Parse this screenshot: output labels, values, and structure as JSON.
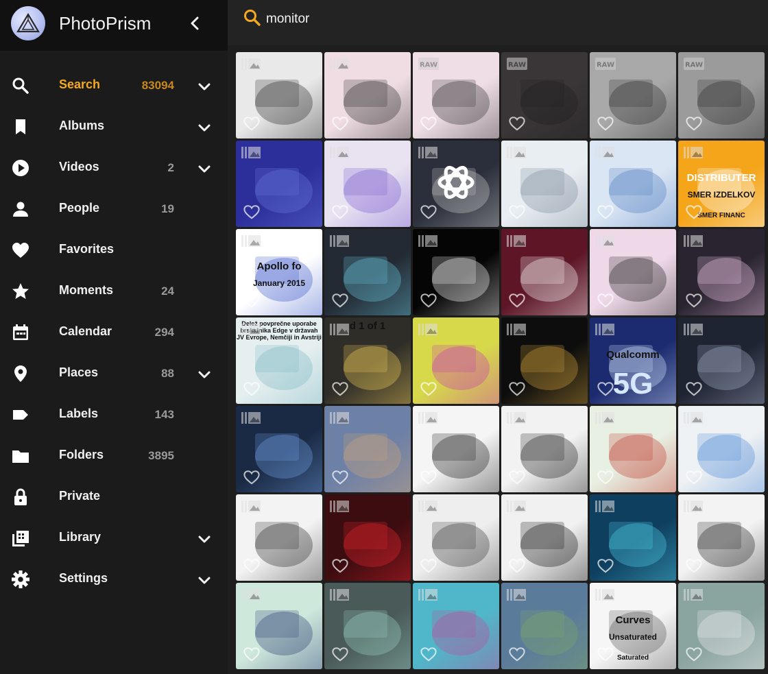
{
  "app": {
    "title": "PhotoPrism"
  },
  "search": {
    "value": "monitor"
  },
  "nav": [
    {
      "label": "Search",
      "count": "83094",
      "chevron": true,
      "active": true,
      "icon": "search-icon"
    },
    {
      "label": "Albums",
      "count": "",
      "chevron": true,
      "icon": "bookmark-icon"
    },
    {
      "label": "Videos",
      "count": "2",
      "chevron": true,
      "icon": "play-circle-icon"
    },
    {
      "label": "People",
      "count": "19",
      "chevron": false,
      "icon": "person-icon"
    },
    {
      "label": "Favorites",
      "count": "",
      "chevron": false,
      "icon": "heart-icon"
    },
    {
      "label": "Moments",
      "count": "24",
      "chevron": false,
      "icon": "star-icon"
    },
    {
      "label": "Calendar",
      "count": "294",
      "chevron": false,
      "icon": "calendar-icon"
    },
    {
      "label": "Places",
      "count": "88",
      "chevron": true,
      "icon": "map-pin-icon"
    },
    {
      "label": "Labels",
      "count": "143",
      "chevron": false,
      "icon": "label-icon"
    },
    {
      "label": "Folders",
      "count": "3895",
      "chevron": false,
      "icon": "folder-icon"
    },
    {
      "label": "Private",
      "count": "",
      "chevron": false,
      "icon": "lock-icon"
    },
    {
      "label": "Library",
      "count": "",
      "chevron": true,
      "icon": "library-icon"
    },
    {
      "label": "Settings",
      "count": "",
      "chevron": true,
      "icon": "gear-icon"
    }
  ],
  "colors": {
    "accent": "#f6a91c",
    "sidebar": "#1b1b1b",
    "brand_bar": "#111111",
    "main": "#1e1e1e"
  },
  "tiles": [
    {
      "bg": "#e9e9e9",
      "fg": "#2b2b2b",
      "badge": "image"
    },
    {
      "bg": "#f0dde4",
      "fg": "#2c2c2c",
      "badge": "image"
    },
    {
      "bg": "#efdee6",
      "fg": "#333333",
      "badge": "raw"
    },
    {
      "bg": "#3a3638",
      "fg": "#1e1e1e",
      "badge": "raw"
    },
    {
      "bg": "#a9a8a8",
      "fg": "#2d2d2d",
      "badge": "raw"
    },
    {
      "bg": "#9c9b9b",
      "fg": "#2a2a2a",
      "badge": "raw"
    },
    {
      "bg": "#2c2f9a",
      "fg": "#6b78e0",
      "badge": "image"
    },
    {
      "bg": "#e8e2f1",
      "fg": "#7a5bd1",
      "badge": "image"
    },
    {
      "bg": "#2b2f3b",
      "fg": "#cccccc",
      "badge": "image",
      "caption": "",
      "glyph": "knot"
    },
    {
      "bg": "#e9eef3",
      "fg": "#7d8c9c",
      "badge": "image"
    },
    {
      "bg": "#dbe6f4",
      "fg": "#4a7bc0",
      "badge": "image"
    },
    {
      "bg": "#f4a51a",
      "fg": "#ffffff",
      "badge": "image",
      "text1": "DISTRIBUTER",
      "text2": "SMER IZDELKOV",
      "text3": "SMER FINANC"
    },
    {
      "bg": "#ffffff",
      "fg": "#3a57c9",
      "badge": "image",
      "text1": "Apollo fo",
      "text2": "January 2015"
    },
    {
      "bg": "#232a33",
      "fg": "#6ac8df",
      "badge": "image"
    },
    {
      "bg": "#050505",
      "fg": "#ffffff",
      "badge": "image"
    },
    {
      "bg": "#5e1627",
      "fg": "#ffffff",
      "badge": "image"
    },
    {
      "bg": "#efd9e9",
      "fg": "#222222",
      "badge": "image"
    },
    {
      "bg": "#2a2430",
      "fg": "#f0c6e8",
      "badge": "image"
    },
    {
      "bg": "#e6eff0",
      "fg": "#7bb8c2",
      "badge": "image",
      "text1": "Delež povprečne uporabe brskalnika Edge v državah JV Evrope, Nemčiji in Avstriji"
    },
    {
      "bg": "#2f2d28",
      "fg": "#f4d05a",
      "badge": "image",
      "text1": "d 1 of 1"
    },
    {
      "bg": "#d7d94a",
      "fg": "#c838b8",
      "badge": "image"
    },
    {
      "bg": "#0d0d0d",
      "fg": "#d3a33c",
      "badge": "image"
    },
    {
      "bg": "#1c2b6f",
      "fg": "#d6e8ff",
      "badge": "image",
      "text1": "Qualcomm",
      "text2": "5G"
    },
    {
      "bg": "#1f2433",
      "fg": "#a8b1c9",
      "badge": "image"
    },
    {
      "bg": "#1a2a44",
      "fg": "#6fa1e6",
      "badge": "image"
    },
    {
      "bg": "#6d80a6",
      "fg": "#cfa77b",
      "badge": "image"
    },
    {
      "bg": "#f5f5f5",
      "fg": "#1b1b1b",
      "badge": "image"
    },
    {
      "bg": "#f2f2f2",
      "fg": "#1f1f1f",
      "badge": "image"
    },
    {
      "bg": "#e8efe3",
      "fg": "#c0392b",
      "badge": "image"
    },
    {
      "bg": "#eef1f4",
      "fg": "#4d8ad6",
      "badge": "image"
    },
    {
      "bg": "#f3f3f3",
      "fg": "#2c2c2c",
      "badge": "image"
    },
    {
      "bg": "#3b0c10",
      "fg": "#e7242d",
      "badge": "image"
    },
    {
      "bg": "#eeeeee",
      "fg": "#3a3a3a",
      "badge": "image"
    },
    {
      "bg": "#f1f1f1",
      "fg": "#111111",
      "badge": "image"
    },
    {
      "bg": "#0f3f5f",
      "fg": "#4fd2ea",
      "badge": "image"
    },
    {
      "bg": "#f3f3f3",
      "fg": "#232323",
      "badge": "image"
    },
    {
      "bg": "#cfe8dc",
      "fg": "#2a3f74",
      "badge": "image"
    },
    {
      "bg": "#4a5a58",
      "fg": "#9bd0c6",
      "badge": "image"
    },
    {
      "bg": "#4fb7c9",
      "fg": "#c04a98",
      "badge": "image"
    },
    {
      "bg": "#5b7b9b",
      "fg": "#7fa866",
      "badge": "image"
    },
    {
      "bg": "#f6f6f6",
      "fg": "#555555",
      "badge": "image",
      "text1": "Curves",
      "text2": "Unsaturated",
      "text3": "Saturated"
    },
    {
      "bg": "#8aa4a0",
      "fg": "#efefef",
      "badge": "image"
    }
  ]
}
